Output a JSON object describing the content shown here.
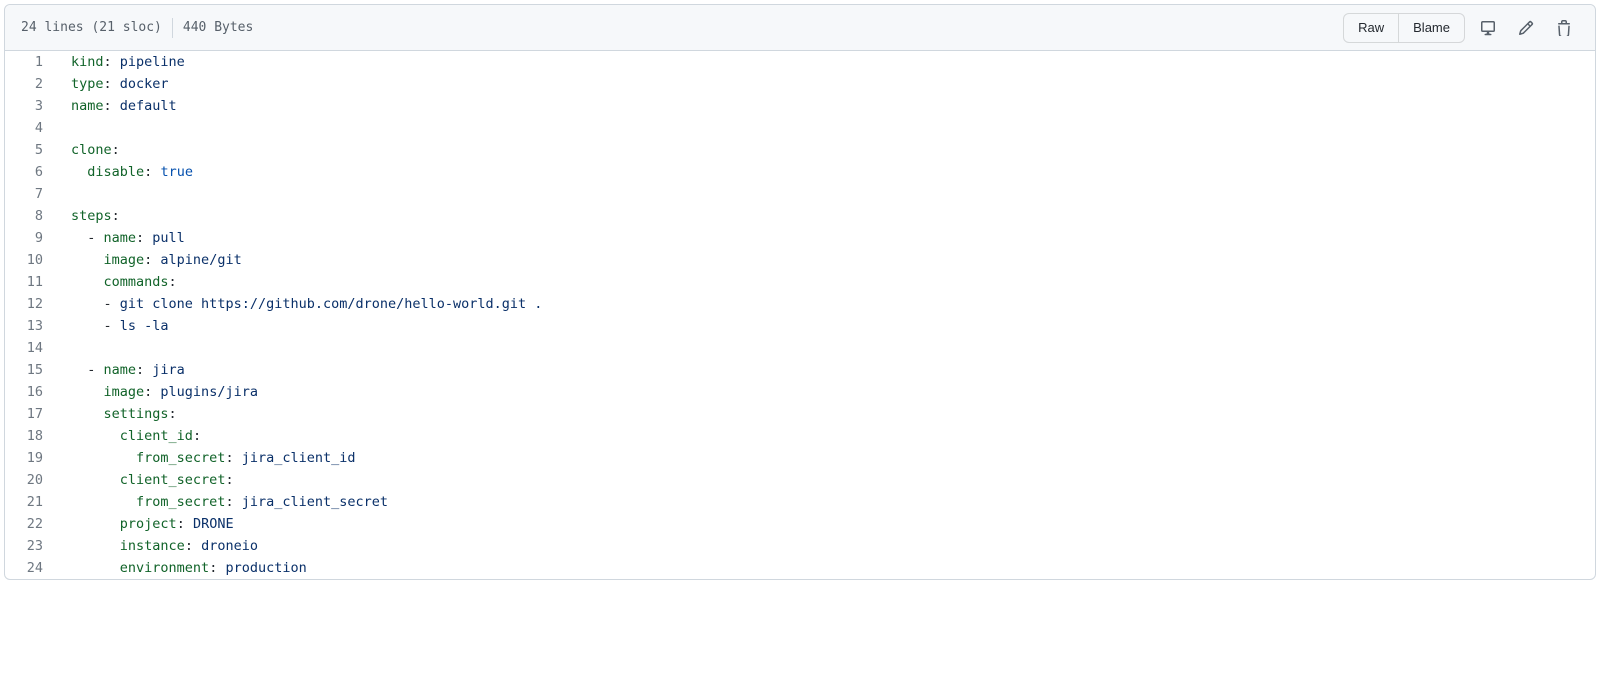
{
  "header": {
    "info_lines": "24 lines (21 sloc)",
    "info_size": "440 Bytes",
    "raw_label": "Raw",
    "blame_label": "Blame"
  },
  "code": {
    "lines": [
      {
        "n": 1,
        "segments": [
          {
            "t": "kind",
            "c": "pl-ent"
          },
          {
            "t": ": "
          },
          {
            "t": "pipeline",
            "c": "pl-s"
          }
        ]
      },
      {
        "n": 2,
        "segments": [
          {
            "t": "type",
            "c": "pl-ent"
          },
          {
            "t": ": "
          },
          {
            "t": "docker",
            "c": "pl-s"
          }
        ]
      },
      {
        "n": 3,
        "segments": [
          {
            "t": "name",
            "c": "pl-ent"
          },
          {
            "t": ": "
          },
          {
            "t": "default",
            "c": "pl-s"
          }
        ]
      },
      {
        "n": 4,
        "segments": [
          {
            "t": ""
          }
        ]
      },
      {
        "n": 5,
        "segments": [
          {
            "t": "clone",
            "c": "pl-ent"
          },
          {
            "t": ":"
          }
        ]
      },
      {
        "n": 6,
        "segments": [
          {
            "t": "  "
          },
          {
            "t": "disable",
            "c": "pl-ent"
          },
          {
            "t": ": "
          },
          {
            "t": "true",
            "c": "pl-c1"
          }
        ]
      },
      {
        "n": 7,
        "segments": [
          {
            "t": ""
          }
        ]
      },
      {
        "n": 8,
        "segments": [
          {
            "t": "steps",
            "c": "pl-ent"
          },
          {
            "t": ":"
          }
        ]
      },
      {
        "n": 9,
        "segments": [
          {
            "t": "  - "
          },
          {
            "t": "name",
            "c": "pl-ent"
          },
          {
            "t": ": "
          },
          {
            "t": "pull",
            "c": "pl-s"
          }
        ]
      },
      {
        "n": 10,
        "segments": [
          {
            "t": "    "
          },
          {
            "t": "image",
            "c": "pl-ent"
          },
          {
            "t": ": "
          },
          {
            "t": "alpine/git",
            "c": "pl-s"
          }
        ]
      },
      {
        "n": 11,
        "segments": [
          {
            "t": "    "
          },
          {
            "t": "commands",
            "c": "pl-ent"
          },
          {
            "t": ":"
          }
        ]
      },
      {
        "n": 12,
        "segments": [
          {
            "t": "    - "
          },
          {
            "t": "git clone https://github.com/drone/hello-world.git .",
            "c": "pl-s"
          }
        ]
      },
      {
        "n": 13,
        "segments": [
          {
            "t": "    - "
          },
          {
            "t": "ls -la",
            "c": "pl-s"
          }
        ]
      },
      {
        "n": 14,
        "segments": [
          {
            "t": ""
          }
        ]
      },
      {
        "n": 15,
        "segments": [
          {
            "t": "  - "
          },
          {
            "t": "name",
            "c": "pl-ent"
          },
          {
            "t": ": "
          },
          {
            "t": "jira",
            "c": "pl-s"
          }
        ]
      },
      {
        "n": 16,
        "segments": [
          {
            "t": "    "
          },
          {
            "t": "image",
            "c": "pl-ent"
          },
          {
            "t": ": "
          },
          {
            "t": "plugins/jira",
            "c": "pl-s"
          }
        ]
      },
      {
        "n": 17,
        "segments": [
          {
            "t": "    "
          },
          {
            "t": "settings",
            "c": "pl-ent"
          },
          {
            "t": ":"
          }
        ]
      },
      {
        "n": 18,
        "segments": [
          {
            "t": "      "
          },
          {
            "t": "client_id",
            "c": "pl-ent"
          },
          {
            "t": ":"
          }
        ]
      },
      {
        "n": 19,
        "segments": [
          {
            "t": "        "
          },
          {
            "t": "from_secret",
            "c": "pl-ent"
          },
          {
            "t": ": "
          },
          {
            "t": "jira_client_id",
            "c": "pl-s"
          }
        ]
      },
      {
        "n": 20,
        "segments": [
          {
            "t": "      "
          },
          {
            "t": "client_secret",
            "c": "pl-ent"
          },
          {
            "t": ":"
          }
        ]
      },
      {
        "n": 21,
        "segments": [
          {
            "t": "        "
          },
          {
            "t": "from_secret",
            "c": "pl-ent"
          },
          {
            "t": ": "
          },
          {
            "t": "jira_client_secret",
            "c": "pl-s"
          }
        ]
      },
      {
        "n": 22,
        "segments": [
          {
            "t": "      "
          },
          {
            "t": "project",
            "c": "pl-ent"
          },
          {
            "t": ": "
          },
          {
            "t": "DRONE",
            "c": "pl-s"
          }
        ]
      },
      {
        "n": 23,
        "segments": [
          {
            "t": "      "
          },
          {
            "t": "instance",
            "c": "pl-ent"
          },
          {
            "t": ": "
          },
          {
            "t": "droneio",
            "c": "pl-s"
          }
        ]
      },
      {
        "n": 24,
        "segments": [
          {
            "t": "      "
          },
          {
            "t": "environment",
            "c": "pl-ent"
          },
          {
            "t": ": "
          },
          {
            "t": "production",
            "c": "pl-s"
          }
        ]
      }
    ]
  }
}
